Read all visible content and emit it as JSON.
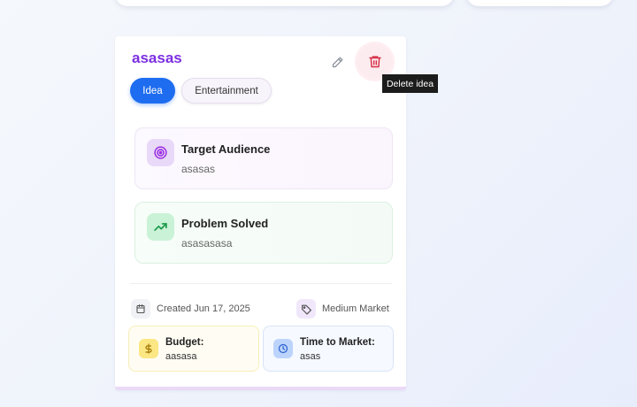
{
  "card": {
    "title": "asasas",
    "edit_icon": "pencil-icon",
    "delete_icon": "trash-icon",
    "delete_tooltip": "Delete idea",
    "tags": [
      {
        "label": "Idea",
        "active": true
      },
      {
        "label": "Entertainment",
        "active": false
      }
    ],
    "target_audience": {
      "label": "Target Audience",
      "value": "asasas",
      "icon": "target-icon"
    },
    "problem_solved": {
      "label": "Problem Solved",
      "value": "asasasasa",
      "icon": "trending-up-icon"
    },
    "created": {
      "text": "Created Jun 17, 2025",
      "icon": "calendar-icon"
    },
    "market": {
      "text": "Medium Market",
      "icon": "tag-icon"
    },
    "budget": {
      "label": "Budget:",
      "value": "aasasa",
      "icon": "dollar-icon"
    },
    "time_to_market": {
      "label": "Time to Market:",
      "value": "asas",
      "icon": "clock-icon"
    }
  },
  "colors": {
    "title": "#7c2fe0",
    "primary": "#1e6df0",
    "delete": "#d63048"
  }
}
